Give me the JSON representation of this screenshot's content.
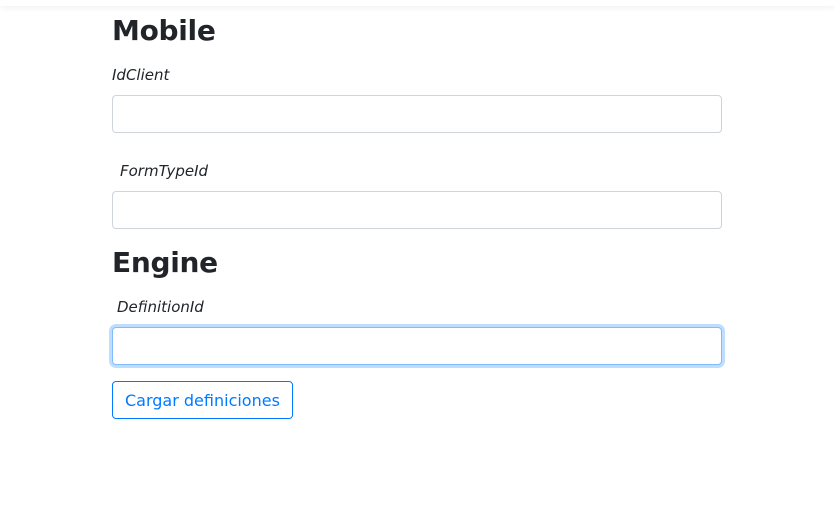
{
  "sections": {
    "mobile": {
      "heading": "Mobile",
      "fields": [
        {
          "label": "IdClient",
          "value": "",
          "placeholder": ""
        },
        {
          "label": "FormTypeId",
          "value": "",
          "placeholder": ""
        }
      ]
    },
    "engine": {
      "heading": "Engine",
      "fields": [
        {
          "label": "DefinitionId",
          "value": "",
          "placeholder": ""
        }
      ],
      "load_button_label": "Cargar definiciones"
    }
  },
  "colors": {
    "text": "#212529",
    "input_border": "#ced4da",
    "focus_border": "#80bdff",
    "button_accent": "#007bff"
  }
}
